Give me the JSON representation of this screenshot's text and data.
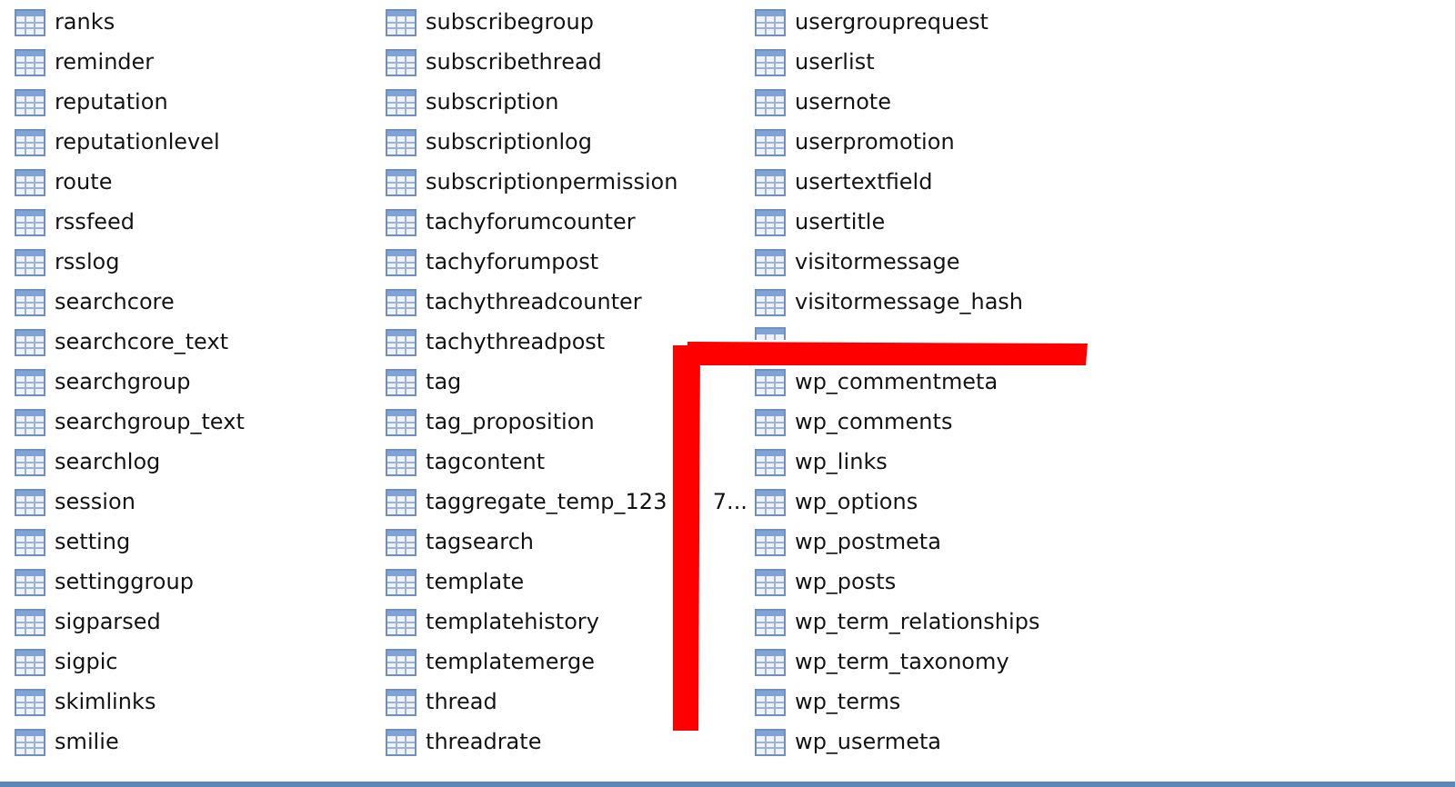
{
  "columns": [
    {
      "items": [
        {
          "label": "ranks"
        },
        {
          "label": "reminder"
        },
        {
          "label": "reputation"
        },
        {
          "label": "reputationlevel"
        },
        {
          "label": "route"
        },
        {
          "label": "rssfeed"
        },
        {
          "label": "rsslog"
        },
        {
          "label": "searchcore"
        },
        {
          "label": "searchcore_text"
        },
        {
          "label": "searchgroup"
        },
        {
          "label": "searchgroup_text"
        },
        {
          "label": "searchlog"
        },
        {
          "label": "session"
        },
        {
          "label": "setting"
        },
        {
          "label": "settinggroup"
        },
        {
          "label": "sigparsed"
        },
        {
          "label": "sigpic"
        },
        {
          "label": "skimlinks"
        },
        {
          "label": "smilie"
        }
      ]
    },
    {
      "items": [
        {
          "label": "subscribegroup"
        },
        {
          "label": "subscribethread"
        },
        {
          "label": "subscription"
        },
        {
          "label": "subscriptionlog"
        },
        {
          "label": "subscriptionpermission"
        },
        {
          "label": "tachyforumcounter"
        },
        {
          "label": "tachyforumpost"
        },
        {
          "label": "tachythreadcounter"
        },
        {
          "label": "tachythreadpost"
        },
        {
          "label": "tag"
        },
        {
          "label": "tag_proposition"
        },
        {
          "label": "tagcontent"
        },
        {
          "label": "taggregate_temp_123",
          "tail": "7..."
        },
        {
          "label": "tagsearch"
        },
        {
          "label": "template"
        },
        {
          "label": "templatehistory"
        },
        {
          "label": "templatemerge"
        },
        {
          "label": "thread"
        },
        {
          "label": "threadrate"
        }
      ]
    },
    {
      "items": [
        {
          "label": "usergrouprequest"
        },
        {
          "label": "userlist"
        },
        {
          "label": "usernote"
        },
        {
          "label": "userpromotion"
        },
        {
          "label": "usertextfield"
        },
        {
          "label": "usertitle"
        },
        {
          "label": "visitormessage"
        },
        {
          "label": "visitormessage_hash"
        },
        {
          "kind": "covered"
        },
        {
          "label": "wp_commentmeta"
        },
        {
          "label": "wp_comments"
        },
        {
          "label": "wp_links"
        },
        {
          "label": "wp_options"
        },
        {
          "label": "wp_postmeta"
        },
        {
          "label": "wp_posts"
        },
        {
          "label": "wp_term_relationships"
        },
        {
          "label": "wp_term_taxonomy"
        },
        {
          "label": "wp_terms"
        },
        {
          "label": "wp_usermeta"
        }
      ]
    }
  ]
}
